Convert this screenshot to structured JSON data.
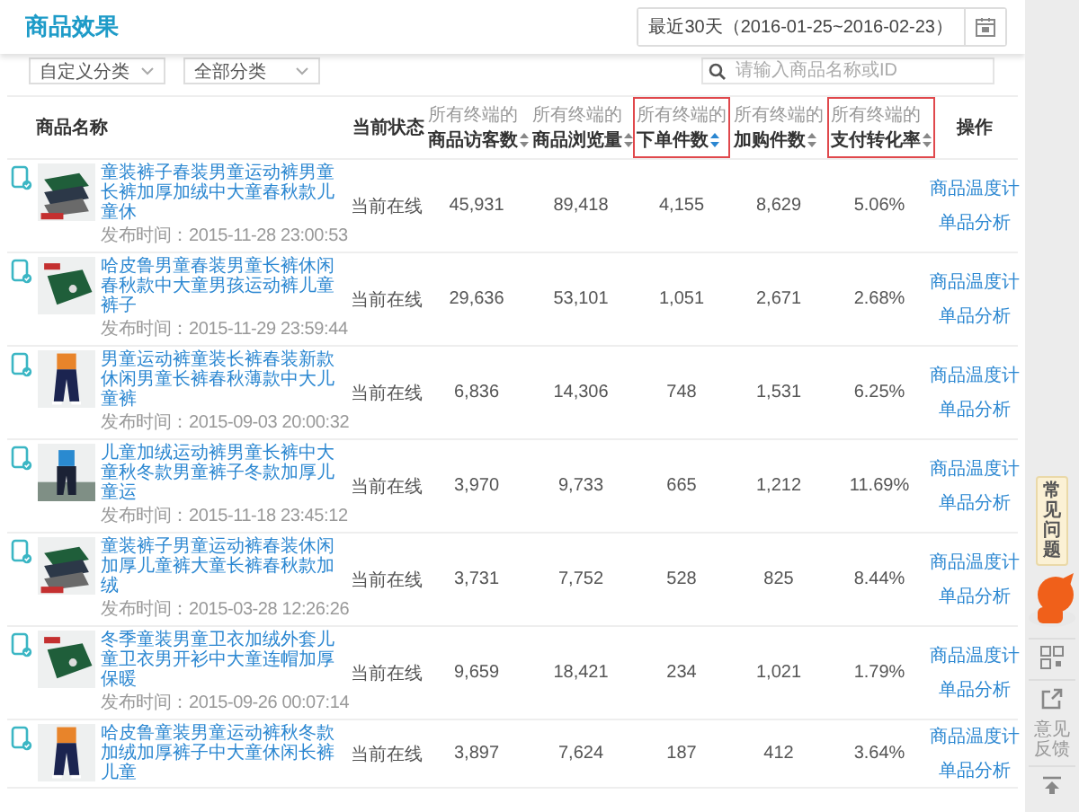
{
  "header": {
    "title": "商品效果",
    "date_range": "最近30天（2016-01-25~2016-02-23）"
  },
  "filters": {
    "dropdowns": [
      "自定义分类",
      "全部分类"
    ],
    "search": {
      "placeholder": "请输入商品名称或ID"
    }
  },
  "table": {
    "columns": [
      {
        "kind": "plain",
        "label": "商品名称",
        "highlighted": false
      },
      {
        "kind": "plain",
        "label": "当前状态",
        "highlighted": false
      },
      {
        "kind": "metric",
        "prefix": "所有终端的",
        "label": "商品访客数",
        "sort_active": false,
        "highlighted": false
      },
      {
        "kind": "metric",
        "prefix": "所有终端的",
        "label": "商品浏览量",
        "sort_active": false,
        "highlighted": false
      },
      {
        "kind": "metric",
        "prefix": "所有终端的",
        "label": "下单件数",
        "sort_active": true,
        "highlighted": true
      },
      {
        "kind": "metric",
        "prefix": "所有终端的",
        "label": "加购件数",
        "sort_active": false,
        "highlighted": false
      },
      {
        "kind": "metric",
        "prefix": "所有终端的",
        "label": "支付转化率",
        "sort_active": false,
        "highlighted": true
      },
      {
        "kind": "plain",
        "label": "操作",
        "highlighted": false
      }
    ],
    "rows": [
      {
        "title": "童装裤子春装男童运动裤男童长裤加厚加绒中大童春秋款儿童休",
        "published": "发布时间：2015-11-28 23:00:53",
        "status": "当前在线",
        "values": [
          "45,931",
          "89,418",
          "4,155",
          "8,629",
          "5.06%"
        ],
        "actions": [
          "商品温度计",
          "单品分析"
        ]
      },
      {
        "title": "哈皮鲁男童春装男童长裤休闲春秋款中大童男孩运动裤儿童裤子",
        "published": "发布时间：2015-11-29 23:59:44",
        "status": "当前在线",
        "values": [
          "29,636",
          "53,101",
          "1,051",
          "2,671",
          "2.68%"
        ],
        "actions": [
          "商品温度计",
          "单品分析"
        ]
      },
      {
        "title": "男童运动裤童装长裤春装新款休闲男童长裤春秋薄款中大儿童裤",
        "published": "发布时间：2015-09-03 20:00:32",
        "status": "当前在线",
        "values": [
          "6,836",
          "14,306",
          "748",
          "1,531",
          "6.25%"
        ],
        "actions": [
          "商品温度计",
          "单品分析"
        ]
      },
      {
        "title": "儿童加绒运动裤男童长裤中大童秋冬款男童裤子冬款加厚儿童运",
        "published": "发布时间：2015-11-18 23:45:12",
        "status": "当前在线",
        "values": [
          "3,970",
          "9,733",
          "665",
          "1,212",
          "11.69%"
        ],
        "actions": [
          "商品温度计",
          "单品分析"
        ]
      },
      {
        "title": "童装裤子男童运动裤春装休闲加厚儿童裤大童长裤春秋款加绒",
        "published": "发布时间：2015-03-28 12:26:26",
        "status": "当前在线",
        "values": [
          "3,731",
          "7,752",
          "528",
          "825",
          "8.44%"
        ],
        "actions": [
          "商品温度计",
          "单品分析"
        ]
      },
      {
        "title": "冬季童装男童卫衣加绒外套儿童卫衣男开衫中大童连帽加厚保暖",
        "published": "发布时间：2015-09-26 00:07:14",
        "status": "当前在线",
        "values": [
          "9,659",
          "18,421",
          "234",
          "1,021",
          "1.79%"
        ],
        "actions": [
          "商品温度计",
          "单品分析"
        ]
      },
      {
        "title": "哈皮鲁童装男童运动裤秋冬款加绒加厚裤子中大童休闲长裤儿童",
        "status": "当前在线",
        "values": [
          "3,897",
          "7,624",
          "187",
          "412",
          "3.64%"
        ],
        "actions": [
          "商品温度计",
          "单品分析"
        ]
      }
    ]
  },
  "sidebar": {
    "faq": "常见问题",
    "feedback": "意见反馈"
  }
}
